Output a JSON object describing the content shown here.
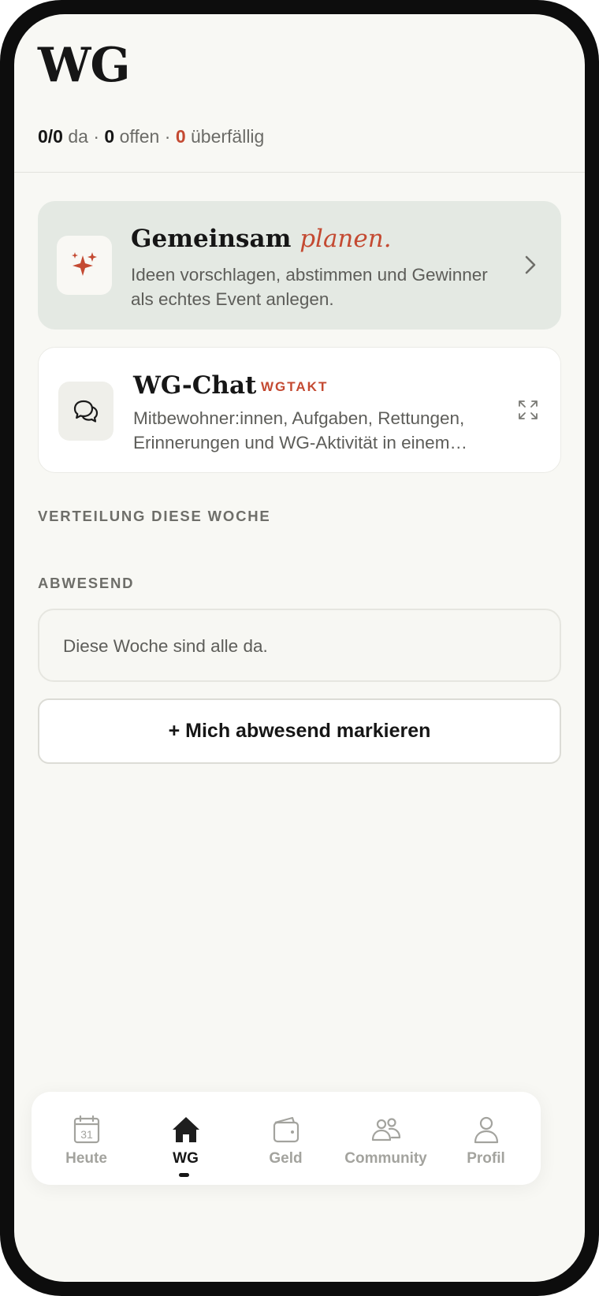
{
  "header": {
    "title": "WG",
    "stats": {
      "present": "0/0",
      "present_label": "da",
      "separator": "·",
      "open": "0",
      "open_label": "offen",
      "overdue": "0",
      "overdue_label": "überfällig"
    }
  },
  "plan_card": {
    "title": "Gemeinsam",
    "title_accent": "planen.",
    "description": "Ideen vorschlagen, abstimmen und Gewinner als echtes Event anlegen.",
    "icon": "sparkles-icon",
    "chevron": "chevron-right-icon"
  },
  "chat_card": {
    "title": "WG-Chat",
    "badge": "WGTAKT",
    "description_line1": "Mitbewohner:innen, Aufgaben, Rettungen,",
    "description_line2": "Erinnerungen und WG-Aktivität in einem…",
    "icon": "chat-bubbles-icon",
    "action_icon": "expand-icon"
  },
  "sections": {
    "distribution": "VERTEILUNG DIESE WOCHE",
    "absent": "ABWESEND"
  },
  "absent": {
    "empty_text": "Diese Woche sind alle da.",
    "mark_button": "+ Mich abwesend markieren"
  },
  "tabbar": {
    "items": [
      {
        "label": "Heute",
        "icon": "calendar-icon",
        "calendar_day": "31"
      },
      {
        "label": "WG",
        "icon": "home-icon",
        "active": true
      },
      {
        "label": "Geld",
        "icon": "wallet-icon"
      },
      {
        "label": "Community",
        "icon": "people-icon"
      },
      {
        "label": "Profil",
        "icon": "profile-icon"
      }
    ]
  },
  "colors": {
    "accent": "#c44a32",
    "background": "#f8f8f4",
    "plan_card_bg": "#e4e9e3",
    "text_primary": "#161616",
    "text_secondary": "#5d5d59"
  }
}
